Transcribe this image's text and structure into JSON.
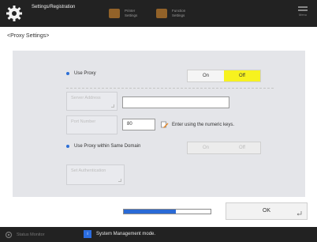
{
  "topbar": {
    "title": "Settings/Registration",
    "buttons": [
      {
        "label": "Printer Settings",
        "icon": "printer-settings-icon"
      },
      {
        "label": "Function Settings",
        "icon": "function-settings-icon"
      }
    ],
    "menu_label": "Menu"
  },
  "page": {
    "title": "<Proxy Settings>"
  },
  "use_proxy": {
    "label": "Use Proxy",
    "options": [
      "On",
      "Off"
    ],
    "selected": "Off"
  },
  "server_address": {
    "button_label": "Server Address",
    "value": ""
  },
  "port_number": {
    "button_label": "Port Number",
    "value": "80",
    "hint": "Enter using the numeric keys."
  },
  "same_domain": {
    "label": "Use Proxy within Same Domain",
    "options": [
      "On",
      "Off"
    ]
  },
  "authentication": {
    "button_label": "Set Authentication"
  },
  "progress": {
    "fraction": 0.6
  },
  "ok": {
    "label": "OK"
  },
  "statusbar": {
    "monitor_label": "Status Monitor",
    "message": "System Management mode."
  },
  "colors": {
    "accent": "#2a6ad6",
    "selected": "#f7f21f",
    "topbar": "#222222",
    "panel": "#e4e5e9"
  }
}
